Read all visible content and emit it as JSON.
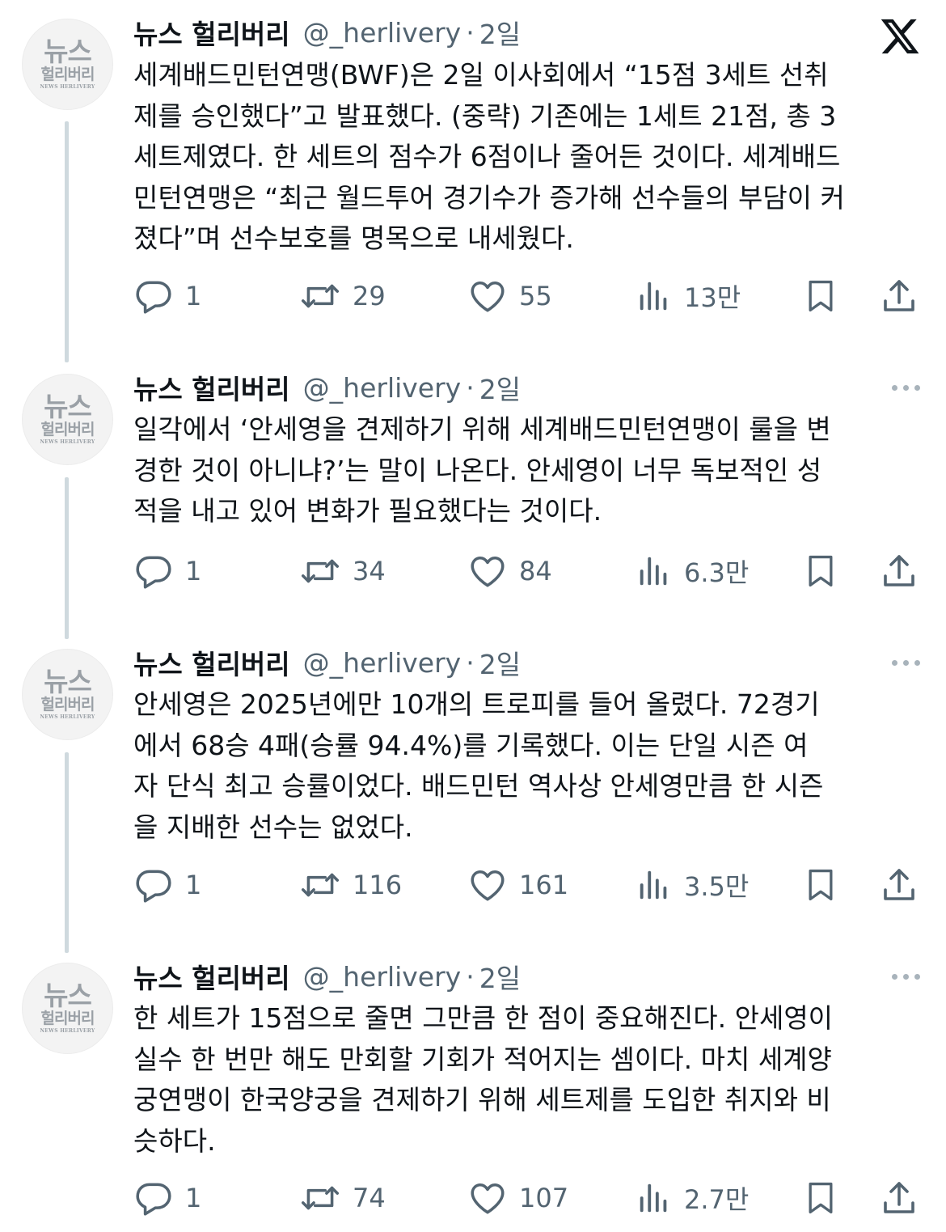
{
  "account": {
    "name": "뉴스 헐리버리",
    "handle": "@_herlivery",
    "separator": "·",
    "avatar_line1": "뉴스",
    "avatar_line2": "헐리버리",
    "avatar_line3": "NEWS HERLIVERY"
  },
  "icons": {
    "brand": "x-logo-icon",
    "reply": "reply-icon",
    "repost": "repost-icon",
    "like": "heart-icon",
    "views": "views-icon",
    "bookmark": "bookmark-icon",
    "share": "share-icon",
    "more": "more-icon"
  },
  "colors": {
    "text": "#0f1419",
    "secondary": "#536471",
    "thread_line": "#cfd9de"
  },
  "tweets": [
    {
      "time": "2일",
      "text": "세계배드민턴연맹(BWF)은 2일 이사회에서 “15점 3세트 선취\n제를 승인했다”고 발표했다. (중략) 기존에는 1세트 21점, 총 3\n세트제였다. 한 세트의 점수가 6점이나 줄어든 것이다. 세계배드\n민턴연맹은 “최근 월드투어 경기수가 증가해 선수들의 부담이 커\n졌다”며 선수보호를 명목으로 내세웠다.",
      "replies": "1",
      "reposts": "29",
      "likes": "55",
      "views": "13만"
    },
    {
      "time": "2일",
      "text": "일각에서 ‘안세영을 견제하기 위해 세계배드민턴연맹이 룰을 변\n경한 것이 아니냐?’는 말이 나온다. 안세영이 너무 독보적인 성\n적을 내고 있어 변화가 필요했다는 것이다.",
      "replies": "1",
      "reposts": "34",
      "likes": "84",
      "views": "6.3만"
    },
    {
      "time": "2일",
      "text": "안세영은 2025년에만 10개의 트로피를 들어 올렸다. 72경기\n에서 68승 4패(승률 94.4%)를 기록했다. 이는 단일 시즌 여\n자 단식 최고 승률이었다. 배드민턴 역사상 안세영만큼 한 시즌\n을 지배한 선수는 없었다.",
      "replies": "1",
      "reposts": "116",
      "likes": "161",
      "views": "3.5만"
    },
    {
      "time": "2일",
      "text": "한 세트가 15점으로 줄면 그만큼 한 점이 중요해진다. 안세영이\n실수 한 번만 해도 만회할 기회가 적어지는 셈이다. 마치 세계양\n궁연맹이 한국양궁을 견제하기 위해 세트제를 도입한 취지와 비\n슷하다.",
      "replies": "1",
      "reposts": "74",
      "likes": "107",
      "views": "2.7만"
    }
  ]
}
